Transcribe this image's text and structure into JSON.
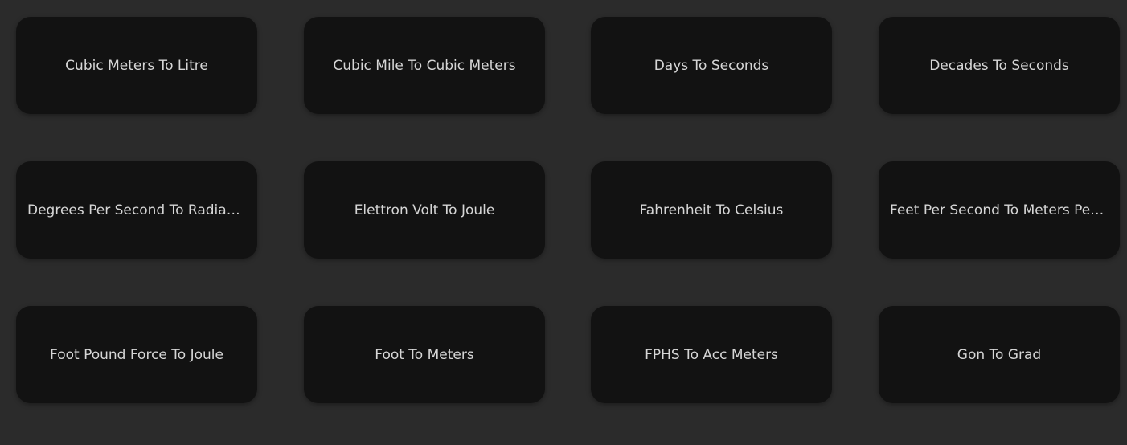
{
  "cards": [
    {
      "label": "Cubic Meters To Litre"
    },
    {
      "label": "Cubic Mile To Cubic Meters"
    },
    {
      "label": "Days To Seconds"
    },
    {
      "label": "Decades To Seconds"
    },
    {
      "label": "Degrees Per Second To Radians Per Second"
    },
    {
      "label": "Elettron Volt To Joule"
    },
    {
      "label": "Fahrenheit To Celsius"
    },
    {
      "label": "Feet Per Second To Meters Per Second"
    },
    {
      "label": "Foot Pound Force To Joule"
    },
    {
      "label": "Foot To Meters"
    },
    {
      "label": "FPHS To Acc Meters"
    },
    {
      "label": "Gon To Grad"
    }
  ],
  "colors": {
    "background": "#2b2b2b",
    "card": "#121212",
    "text": "#d6d6d6"
  }
}
